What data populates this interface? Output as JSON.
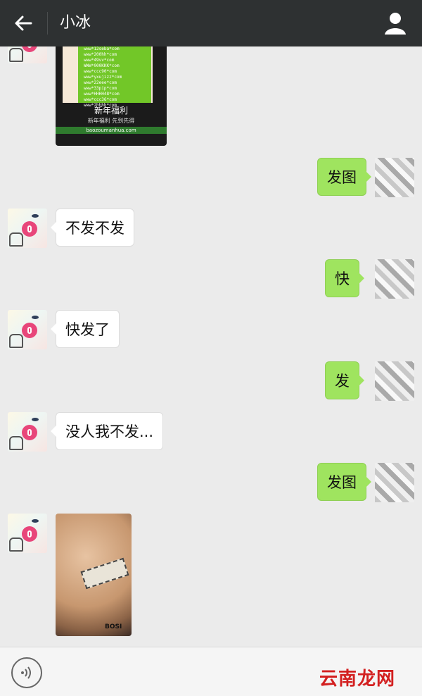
{
  "header": {
    "title": "小冰",
    "back_icon": "back-arrow-icon",
    "profile_icon": "person-icon"
  },
  "messages": [
    {
      "side": "left",
      "type": "image",
      "caption": "新年福利",
      "subcaption": "新年福利 先到先得",
      "footer": "baozoumanhua.com",
      "lines": [
        "www*rb444*com",
        "www*2bbuu*com",
        "www*12seba*com",
        "www*200hh*com",
        "www*49vv*com",
        "WWW*000KKK*com",
        "www*ccc90*com",
        "www*yxujizz*com",
        "www*22eee*com",
        "www*33pip*com",
        "www*HHHH48*com",
        "www*ccc36*com",
        "www*2hhhh*com"
      ]
    },
    {
      "side": "right",
      "type": "text",
      "text": "发图"
    },
    {
      "side": "left",
      "type": "text",
      "text": "不发不发"
    },
    {
      "side": "right",
      "type": "text",
      "text": "快"
    },
    {
      "side": "left",
      "type": "text",
      "text": "快发了"
    },
    {
      "side": "right",
      "type": "text",
      "text": "发"
    },
    {
      "side": "left",
      "type": "text",
      "text": "没人我不发..."
    },
    {
      "side": "right",
      "type": "text",
      "text": "发图"
    },
    {
      "side": "left",
      "type": "image",
      "signature": "BOSI"
    }
  ],
  "input": {
    "voice_icon": "voice-icon"
  },
  "watermark": "云南龙网",
  "colors": {
    "header_bg": "#2e3132",
    "chat_bg": "#ebebeb",
    "sent_bubble": "#9fe45f",
    "received_bubble": "#ffffff"
  }
}
